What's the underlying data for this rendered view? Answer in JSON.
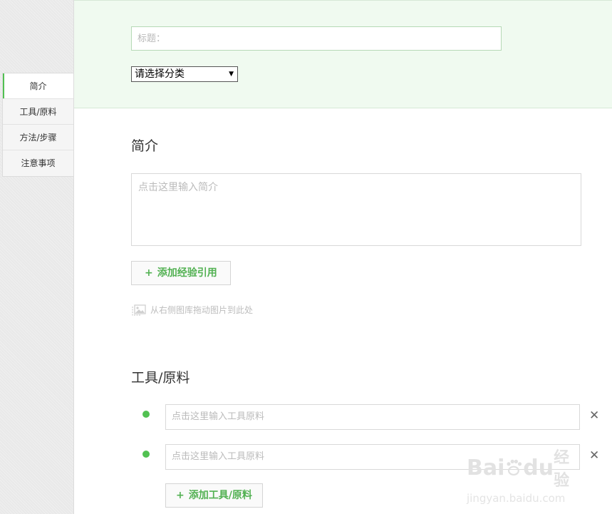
{
  "sidebar": {
    "items": [
      {
        "label": "简介",
        "active": true
      },
      {
        "label": "工具/原料",
        "active": false
      },
      {
        "label": "方法/步骤",
        "active": false
      },
      {
        "label": "注意事项",
        "active": false
      }
    ]
  },
  "header": {
    "title_placeholder": "标题：",
    "category_selected": "请选择分类"
  },
  "intro": {
    "heading": "简介",
    "placeholder": "点击这里输入简介",
    "add_reference_label": "添加经验引用",
    "drag_hint": "从右侧图库拖动图片到此处"
  },
  "tools": {
    "heading": "工具/原料",
    "items": [
      {
        "placeholder": "点击这里输入工具原料"
      },
      {
        "placeholder": "点击这里输入工具原料"
      }
    ],
    "add_label": "添加工具/原料"
  },
  "watermark": {
    "brand": "Bai",
    "brand_suffix": "du",
    "brand_cn": "经验",
    "url": "jingyan.baidu.com"
  },
  "colors": {
    "accent_green": "#52c152",
    "panel_bg": "#f0faf0"
  },
  "icons": {
    "plus": "plus-icon",
    "image": "image-icon",
    "delete": "close-icon",
    "bullet": "bullet-dot-icon"
  }
}
